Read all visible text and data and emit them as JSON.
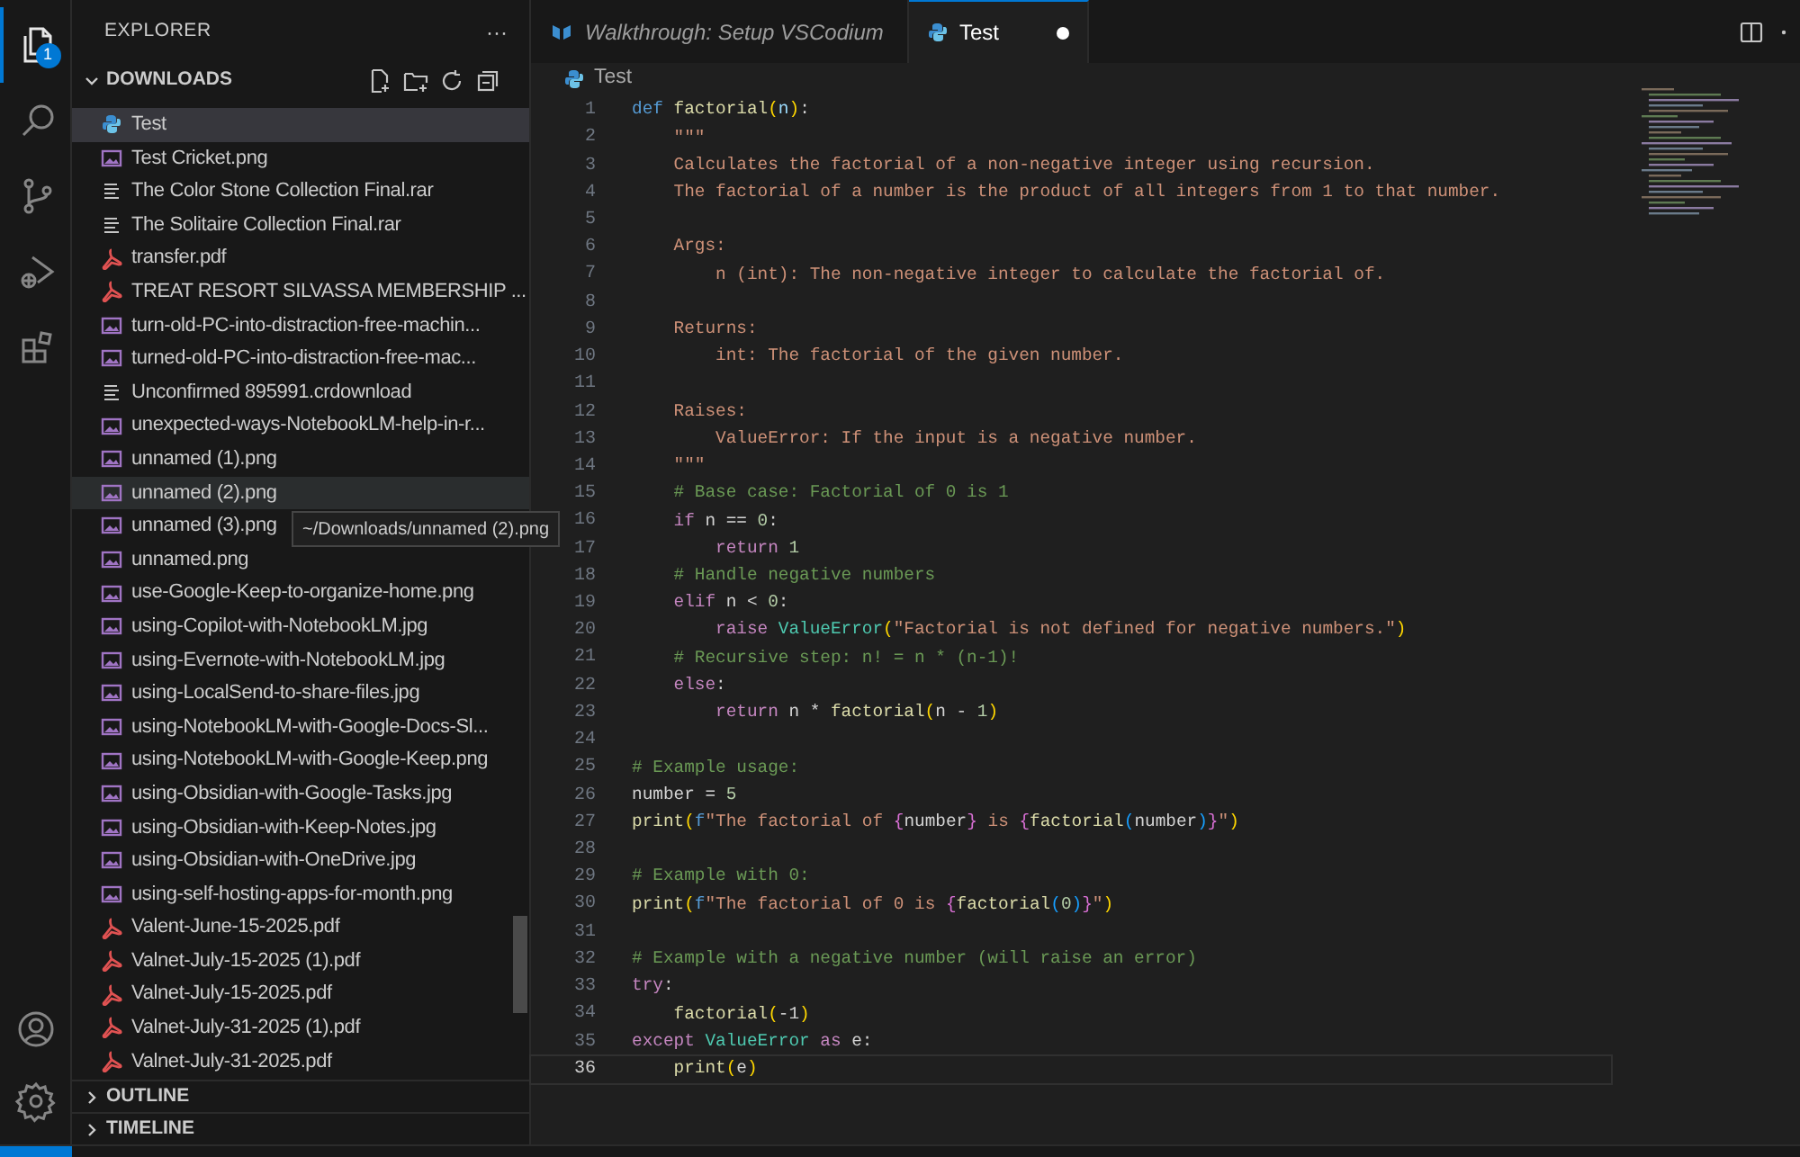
{
  "activity_bar": {
    "items": [
      {
        "kind": "files",
        "selected": true,
        "badge": "1"
      },
      {
        "kind": "search",
        "selected": false
      },
      {
        "kind": "source-control",
        "selected": false
      },
      {
        "kind": "run-debug",
        "selected": false
      },
      {
        "kind": "extensions",
        "selected": false
      }
    ],
    "bottom": [
      {
        "kind": "account"
      },
      {
        "kind": "settings"
      }
    ]
  },
  "sidebar": {
    "title": "EXPLORER",
    "more": "···",
    "section": {
      "label": "DOWNLOADS",
      "expanded": true
    },
    "files": [
      {
        "name": "Test",
        "kind": "python",
        "selected": true,
        "hovered": false
      },
      {
        "name": "Test Cricket.png",
        "kind": "image",
        "selected": false,
        "hovered": false
      },
      {
        "name": "The Color Stone Collection Final.rar",
        "kind": "archive",
        "selected": false,
        "hovered": false
      },
      {
        "name": "The Solitaire Collection Final.rar",
        "kind": "archive",
        "selected": false,
        "hovered": false
      },
      {
        "name": "transfer.pdf",
        "kind": "pdf",
        "selected": false,
        "hovered": false
      },
      {
        "name": "TREAT RESORT SILVASSA MEMBERSHIP ...",
        "kind": "pdf",
        "selected": false,
        "hovered": false
      },
      {
        "name": "turn-old-PC-into-distraction-free-machin...",
        "kind": "image",
        "selected": false,
        "hovered": false
      },
      {
        "name": "turned-old-PC-into-distraction-free-mac...",
        "kind": "image",
        "selected": false,
        "hovered": false
      },
      {
        "name": "Unconfirmed 895991.crdownload",
        "kind": "archive",
        "selected": false,
        "hovered": false
      },
      {
        "name": "unexpected-ways-NotebookLM-help-in-r...",
        "kind": "image",
        "selected": false,
        "hovered": false
      },
      {
        "name": "unnamed (1).png",
        "kind": "image",
        "selected": false,
        "hovered": false
      },
      {
        "name": "unnamed (2).png",
        "kind": "image",
        "selected": false,
        "hovered": true
      },
      {
        "name": "unnamed (3).png",
        "kind": "image",
        "selected": false,
        "hovered": false
      },
      {
        "name": "unnamed.png",
        "kind": "image",
        "selected": false,
        "hovered": false
      },
      {
        "name": "use-Google-Keep-to-organize-home.png",
        "kind": "image",
        "selected": false,
        "hovered": false
      },
      {
        "name": "using-Copilot-with-NotebookLM.jpg",
        "kind": "image",
        "selected": false,
        "hovered": false
      },
      {
        "name": "using-Evernote-with-NotebookLM.jpg",
        "kind": "image",
        "selected": false,
        "hovered": false
      },
      {
        "name": "using-LocalSend-to-share-files.jpg",
        "kind": "image",
        "selected": false,
        "hovered": false
      },
      {
        "name": "using-NotebookLM-with-Google-Docs-Sl...",
        "kind": "image",
        "selected": false,
        "hovered": false
      },
      {
        "name": "using-NotebookLM-with-Google-Keep.png",
        "kind": "image",
        "selected": false,
        "hovered": false
      },
      {
        "name": "using-Obsidian-with-Google-Tasks.jpg",
        "kind": "image",
        "selected": false,
        "hovered": false
      },
      {
        "name": "using-Obsidian-with-Keep-Notes.jpg",
        "kind": "image",
        "selected": false,
        "hovered": false
      },
      {
        "name": "using-Obsidian-with-OneDrive.jpg",
        "kind": "image",
        "selected": false,
        "hovered": false
      },
      {
        "name": "using-self-hosting-apps-for-month.png",
        "kind": "image",
        "selected": false,
        "hovered": false
      },
      {
        "name": "Valent-June-15-2025.pdf",
        "kind": "pdf",
        "selected": false,
        "hovered": false
      },
      {
        "name": "Valnet-July-15-2025 (1).pdf",
        "kind": "pdf",
        "selected": false,
        "hovered": false
      },
      {
        "name": "Valnet-July-15-2025.pdf",
        "kind": "pdf",
        "selected": false,
        "hovered": false
      },
      {
        "name": "Valnet-July-31-2025 (1).pdf",
        "kind": "pdf",
        "selected": false,
        "hovered": false
      },
      {
        "name": "Valnet-July-31-2025.pdf",
        "kind": "pdf",
        "selected": false,
        "hovered": false
      }
    ],
    "tooltip": "~/Downloads/unnamed (2).png",
    "collapsed_sections": [
      {
        "label": "OUTLINE",
        "expanded": false
      },
      {
        "label": "TIMELINE",
        "expanded": false
      }
    ]
  },
  "tabs": [
    {
      "label": "Walkthrough: Setup VSCodium",
      "kind": "walkthrough",
      "selected": false,
      "dirty": false,
      "preview": true
    },
    {
      "label": "Test",
      "kind": "python",
      "selected": true,
      "dirty": true,
      "preview": false
    }
  ],
  "breadcrumb": "Test",
  "code_lines": [
    {
      "n": "1",
      "current": false,
      "tokens": [
        {
          "kind": "kw",
          "text": "def "
        },
        {
          "kind": "fn",
          "text": "factorial"
        },
        {
          "kind": "br",
          "text": "("
        },
        {
          "kind": "param",
          "text": "n"
        },
        {
          "kind": "br",
          "text": ")"
        },
        {
          "kind": "plain",
          "text": ":"
        }
      ]
    },
    {
      "n": "2",
      "current": false,
      "tokens": [
        {
          "kind": "str",
          "text": "    \"\"\""
        }
      ]
    },
    {
      "n": "3",
      "current": false,
      "tokens": [
        {
          "kind": "str",
          "text": "    Calculates the factorial of a non-negative integer using recursion."
        }
      ]
    },
    {
      "n": "4",
      "current": false,
      "tokens": [
        {
          "kind": "str",
          "text": "    The factorial of a number is the product of all integers from 1 to that number."
        }
      ]
    },
    {
      "n": "5",
      "current": false
    },
    {
      "n": "6",
      "current": false,
      "tokens": [
        {
          "kind": "str",
          "text": "    Args:"
        }
      ]
    },
    {
      "n": "7",
      "current": false,
      "tokens": [
        {
          "kind": "str",
          "text": "        n (int): The non-negative integer to calculate the factorial of."
        }
      ]
    },
    {
      "n": "8",
      "current": false
    },
    {
      "n": "9",
      "current": false,
      "tokens": [
        {
          "kind": "str",
          "text": "    Returns:"
        }
      ]
    },
    {
      "n": "10",
      "current": false,
      "tokens": [
        {
          "kind": "str",
          "text": "        int: The factorial of the given number."
        }
      ]
    },
    {
      "n": "11",
      "current": false
    },
    {
      "n": "12",
      "current": false,
      "tokens": [
        {
          "kind": "str",
          "text": "    Raises:"
        }
      ]
    },
    {
      "n": "13",
      "current": false,
      "tokens": [
        {
          "kind": "str",
          "text": "        ValueError: If the input is a negative number."
        }
      ]
    },
    {
      "n": "14",
      "current": false,
      "tokens": [
        {
          "kind": "str",
          "text": "    \"\"\""
        }
      ]
    },
    {
      "n": "15",
      "current": false,
      "tokens": [
        {
          "kind": "cmt",
          "text": "    # Base case: Factorial of 0 is 1"
        }
      ]
    },
    {
      "n": "16",
      "current": false,
      "tokens": [
        {
          "kind": "ctrl",
          "text": "    if"
        },
        {
          "kind": "plain",
          "text": " n == "
        },
        {
          "kind": "num",
          "text": "0"
        },
        {
          "kind": "plain",
          "text": ":"
        }
      ]
    },
    {
      "n": "17",
      "current": false,
      "tokens": [
        {
          "kind": "ctrl",
          "text": "        return "
        },
        {
          "kind": "num",
          "text": "1"
        }
      ]
    },
    {
      "n": "18",
      "current": false,
      "tokens": [
        {
          "kind": "cmt",
          "text": "    # Handle negative numbers"
        }
      ]
    },
    {
      "n": "19",
      "current": false,
      "tokens": [
        {
          "kind": "ctrl",
          "text": "    elif"
        },
        {
          "kind": "plain",
          "text": " n < "
        },
        {
          "kind": "num",
          "text": "0"
        },
        {
          "kind": "plain",
          "text": ":"
        }
      ]
    },
    {
      "n": "20",
      "current": false,
      "tokens": [
        {
          "kind": "ctrl",
          "text": "        raise "
        },
        {
          "kind": "cls",
          "text": "ValueError"
        },
        {
          "kind": "br",
          "text": "("
        },
        {
          "kind": "str",
          "text": "\"Factorial is not defined for negative numbers.\""
        },
        {
          "kind": "br",
          "text": ")"
        }
      ]
    },
    {
      "n": "21",
      "current": false,
      "tokens": [
        {
          "kind": "cmt",
          "text": "    # Recursive step: n! = n * (n-1)!"
        }
      ]
    },
    {
      "n": "22",
      "current": false,
      "tokens": [
        {
          "kind": "ctrl",
          "text": "    else"
        },
        {
          "kind": "plain",
          "text": ":"
        }
      ]
    },
    {
      "n": "23",
      "current": false,
      "tokens": [
        {
          "kind": "ctrl",
          "text": "        return"
        },
        {
          "kind": "plain",
          "text": " n * "
        },
        {
          "kind": "fn",
          "text": "factorial"
        },
        {
          "kind": "br",
          "text": "("
        },
        {
          "kind": "plain",
          "text": "n - "
        },
        {
          "kind": "num",
          "text": "1"
        },
        {
          "kind": "br",
          "text": ")"
        }
      ]
    },
    {
      "n": "24",
      "current": false
    },
    {
      "n": "25",
      "current": false,
      "tokens": [
        {
          "kind": "cmt",
          "text": "# Example usage:"
        }
      ]
    },
    {
      "n": "26",
      "current": false,
      "tokens": [
        {
          "kind": "plain",
          "text": "number = "
        },
        {
          "kind": "num",
          "text": "5"
        }
      ]
    },
    {
      "n": "27",
      "current": false,
      "tokens": [
        {
          "kind": "fn",
          "text": "print"
        },
        {
          "kind": "br",
          "text": "("
        },
        {
          "kind": "kw",
          "text": "f"
        },
        {
          "kind": "str",
          "text": "\"The factorial of "
        },
        {
          "kind": "br2",
          "text": "{"
        },
        {
          "kind": "plain",
          "text": "number"
        },
        {
          "kind": "br2",
          "text": "}"
        },
        {
          "kind": "str",
          "text": " is "
        },
        {
          "kind": "br2",
          "text": "{"
        },
        {
          "kind": "fn",
          "text": "factorial"
        },
        {
          "kind": "br3",
          "text": "("
        },
        {
          "kind": "plain",
          "text": "number"
        },
        {
          "kind": "br3",
          "text": ")"
        },
        {
          "kind": "br2",
          "text": "}"
        },
        {
          "kind": "str",
          "text": "\""
        },
        {
          "kind": "br",
          "text": ")"
        }
      ]
    },
    {
      "n": "28",
      "current": false
    },
    {
      "n": "29",
      "current": false,
      "tokens": [
        {
          "kind": "cmt",
          "text": "# Example with 0:"
        }
      ]
    },
    {
      "n": "30",
      "current": false,
      "tokens": [
        {
          "kind": "fn",
          "text": "print"
        },
        {
          "kind": "br",
          "text": "("
        },
        {
          "kind": "kw",
          "text": "f"
        },
        {
          "kind": "str",
          "text": "\"The factorial of 0 is "
        },
        {
          "kind": "br2",
          "text": "{"
        },
        {
          "kind": "fn",
          "text": "factorial"
        },
        {
          "kind": "br3",
          "text": "("
        },
        {
          "kind": "num",
          "text": "0"
        },
        {
          "kind": "br3",
          "text": ")"
        },
        {
          "kind": "br2",
          "text": "}"
        },
        {
          "kind": "str",
          "text": "\""
        },
        {
          "kind": "br",
          "text": ")"
        }
      ]
    },
    {
      "n": "31",
      "current": false
    },
    {
      "n": "32",
      "current": false,
      "tokens": [
        {
          "kind": "cmt",
          "text": "# Example with a negative number (will raise an error)"
        }
      ]
    },
    {
      "n": "33",
      "current": false,
      "tokens": [
        {
          "kind": "ctrl",
          "text": "try"
        },
        {
          "kind": "plain",
          "text": ":"
        }
      ]
    },
    {
      "n": "34",
      "current": false,
      "tokens": [
        {
          "kind": "fn",
          "text": "    factorial"
        },
        {
          "kind": "br",
          "text": "("
        },
        {
          "kind": "plain",
          "text": "-1"
        },
        {
          "kind": "br",
          "text": ")"
        }
      ]
    },
    {
      "n": "35",
      "current": false,
      "tokens": [
        {
          "kind": "ctrl",
          "text": "except "
        },
        {
          "kind": "cls",
          "text": "ValueError "
        },
        {
          "kind": "ctrl",
          "text": "as"
        },
        {
          "kind": "plain",
          "text": " e:"
        }
      ]
    },
    {
      "n": "36",
      "current": true,
      "tokens": [
        {
          "kind": "fn",
          "text": "    print"
        },
        {
          "kind": "br",
          "text": "("
        },
        {
          "kind": "plain",
          "text": "e"
        },
        {
          "kind": "br",
          "text": ")"
        }
      ]
    }
  ]
}
